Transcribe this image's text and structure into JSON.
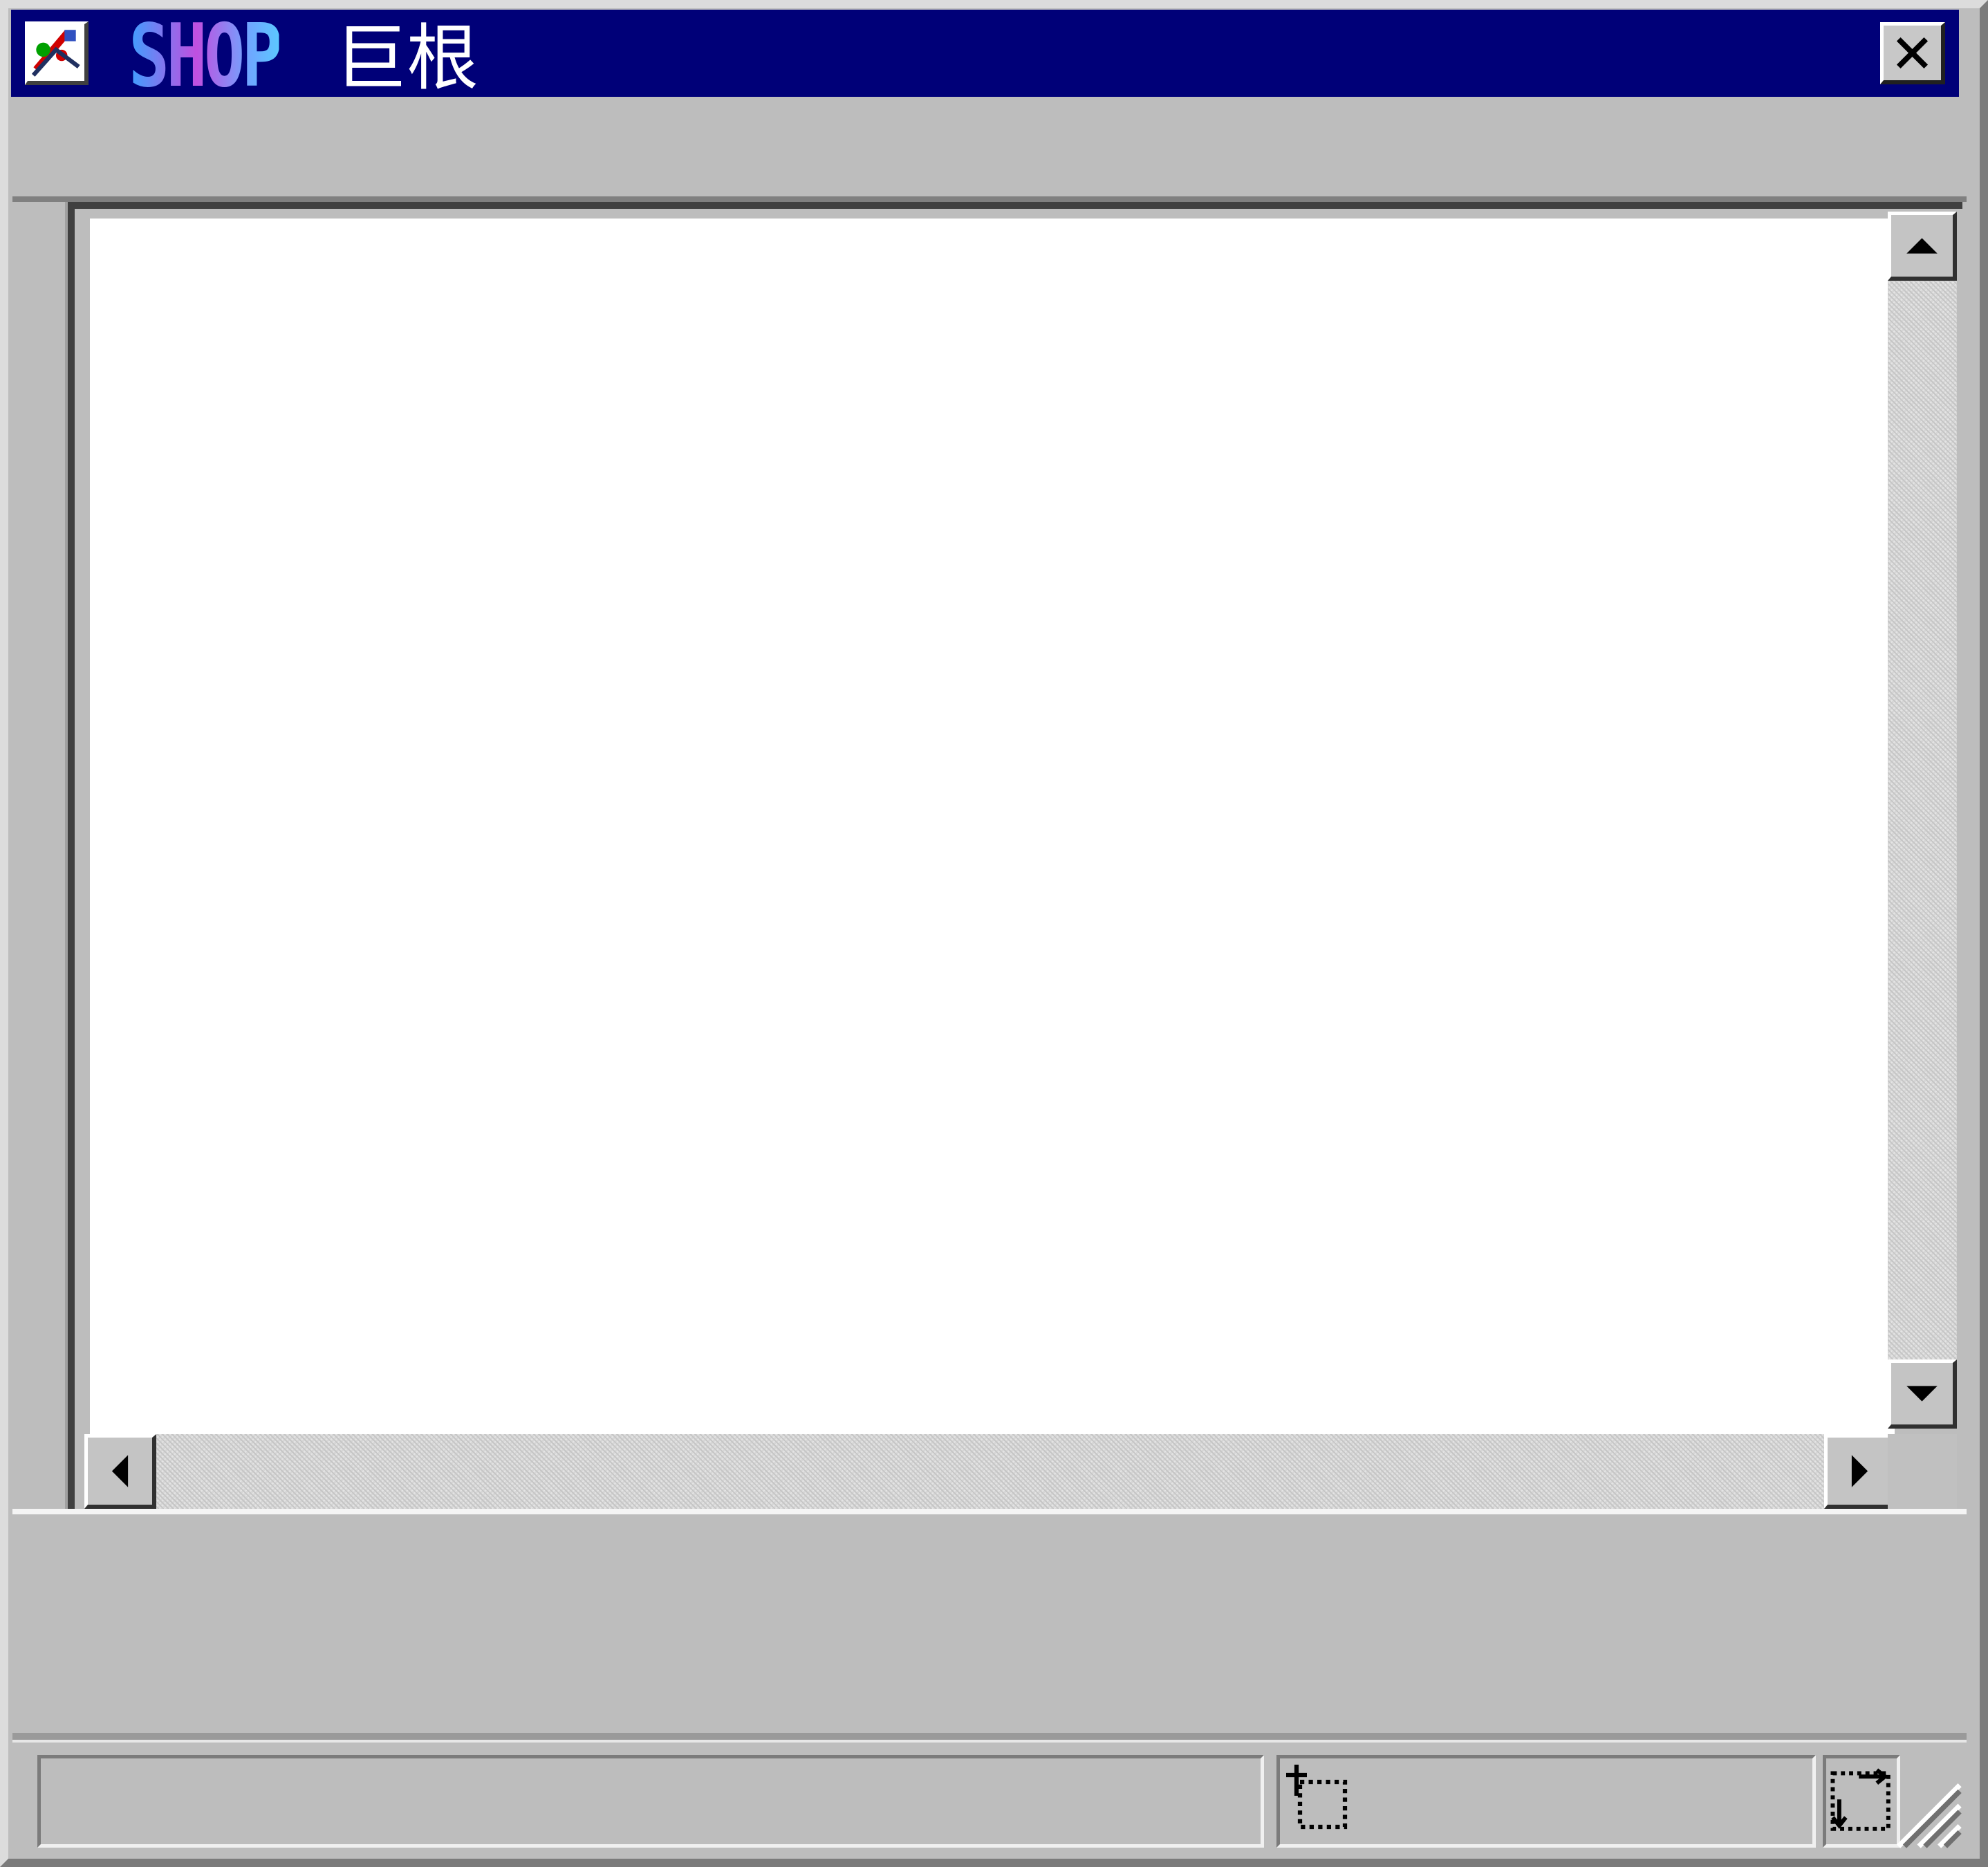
{
  "window": {
    "title_brand": "SHOP",
    "title_text": "巨根",
    "app_icon": "paint-app-icon",
    "close_icon": "close-icon"
  },
  "scrollbars": {
    "vertical": {
      "up_icon": "arrow-up-icon",
      "down_icon": "arrow-down-icon"
    },
    "horizontal": {
      "left_icon": "arrow-left-icon",
      "right_icon": "arrow-right-icon"
    }
  },
  "statusbar": {
    "message": "",
    "position_icon": "cursor-position-icon",
    "size_icon": "selection-size-icon",
    "grip_icon": "resize-grip-icon"
  },
  "colors": {
    "titlebar": "#000078",
    "face": "#bdbdbd",
    "canvas": "#ffffff"
  }
}
